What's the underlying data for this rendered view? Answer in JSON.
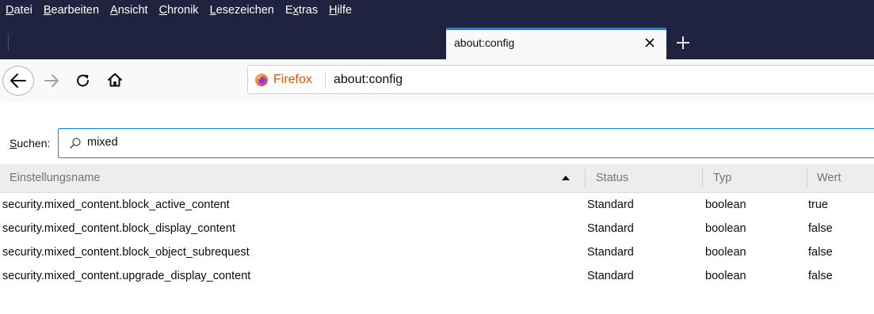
{
  "menubar": {
    "items": [
      {
        "accel": "D",
        "rest": "atei"
      },
      {
        "accel": "B",
        "rest": "earbeiten"
      },
      {
        "accel": "A",
        "rest": "nsicht"
      },
      {
        "accel": "C",
        "rest": "hronik"
      },
      {
        "accel": "L",
        "rest": "esezeichen"
      },
      {
        "pre": "E",
        "accel": "x",
        "rest": "tras"
      },
      {
        "accel": "H",
        "rest": "ilfe"
      }
    ]
  },
  "tab": {
    "title": "about:config"
  },
  "urlbar": {
    "identity_label": "Firefox",
    "url": "about:config"
  },
  "search": {
    "label_accel": "S",
    "label_rest": "uchen:",
    "value": "mixed"
  },
  "table": {
    "columns": [
      "Einstellungsname",
      "Status",
      "Typ",
      "Wert"
    ],
    "rows": [
      {
        "name": "security.mixed_content.block_active_content",
        "status": "Standard",
        "type": "boolean",
        "value": "true"
      },
      {
        "name": "security.mixed_content.block_display_content",
        "status": "Standard",
        "type": "boolean",
        "value": "false"
      },
      {
        "name": "security.mixed_content.block_object_subrequest",
        "status": "Standard",
        "type": "boolean",
        "value": "false"
      },
      {
        "name": "security.mixed_content.upgrade_display_content",
        "status": "Standard",
        "type": "boolean",
        "value": "false"
      }
    ]
  },
  "colors": {
    "titlebar": "#202340",
    "accent": "#0a84ff",
    "firefox_orange": "#d7570d"
  },
  "icons": [
    "back-arrow-icon",
    "forward-arrow-icon",
    "reload-icon",
    "home-icon",
    "firefox-logo-icon",
    "close-icon",
    "plus-icon",
    "search-icon",
    "sort-ascending-icon"
  ]
}
